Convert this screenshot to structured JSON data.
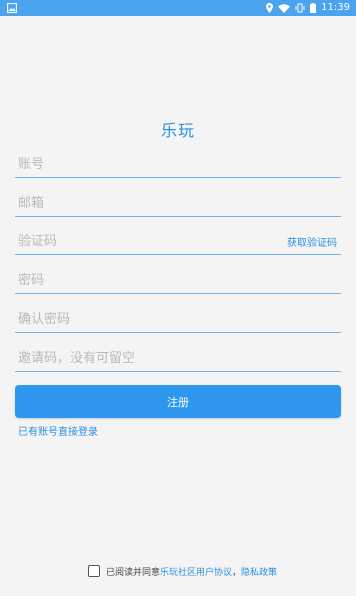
{
  "status_bar": {
    "time": "11:39",
    "icons": [
      "image-icon",
      "location-icon",
      "wifi-icon",
      "vibrate-icon",
      "battery-icon"
    ]
  },
  "app_title": "乐玩",
  "form": {
    "account_placeholder": "账号",
    "email_placeholder": "邮箱",
    "code_placeholder": "验证码",
    "get_code_label": "获取验证码",
    "password_placeholder": "密码",
    "confirm_password_placeholder": "确认密码",
    "invite_placeholder": "邀请码，没有可留空",
    "register_label": "注册",
    "login_link_label": "已有账号直接登录"
  },
  "agreement": {
    "checked": false,
    "prefix": "已阅读并同意",
    "user_agreement": "乐玩社区用户协议",
    "separator": "，",
    "privacy_policy": "隐私政策"
  },
  "colors": {
    "accent": "#2e97ef",
    "status_bar": "#4aa3ef",
    "background": "#f4f4f4",
    "underline": "#6fb4f0"
  }
}
